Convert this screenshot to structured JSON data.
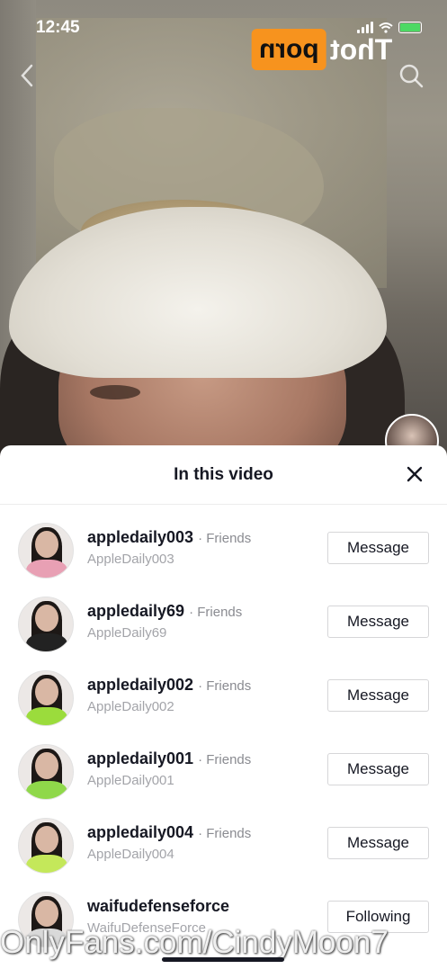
{
  "status_bar": {
    "time": "12:45"
  },
  "watermark_logo": {
    "box_text": "porn",
    "side_text": "Thot"
  },
  "sheet": {
    "title": "In this video",
    "users": [
      {
        "username": "appledaily003",
        "relation": "· Friends",
        "display_name": "AppleDaily003",
        "button": "Message",
        "outfit": "#e8a0b4"
      },
      {
        "username": "appledaily69",
        "relation": "· Friends",
        "display_name": "AppleDaily69",
        "button": "Message",
        "outfit": "#222222"
      },
      {
        "username": "appledaily002",
        "relation": "· Friends",
        "display_name": "AppleDaily002",
        "button": "Message",
        "outfit": "#9bdc3c"
      },
      {
        "username": "appledaily001",
        "relation": "· Friends",
        "display_name": "AppleDaily001",
        "button": "Message",
        "outfit": "#8fd84a"
      },
      {
        "username": "appledaily004",
        "relation": "· Friends",
        "display_name": "AppleDaily004",
        "button": "Message",
        "outfit": "#c4e85a"
      },
      {
        "username": "waifudefenseforce",
        "relation": "",
        "display_name": "WaifuDefenseForce",
        "button": "Following",
        "outfit": "#d9d9d9"
      }
    ]
  },
  "footer_watermark": "OnlyFans.com/CindyMoon7"
}
